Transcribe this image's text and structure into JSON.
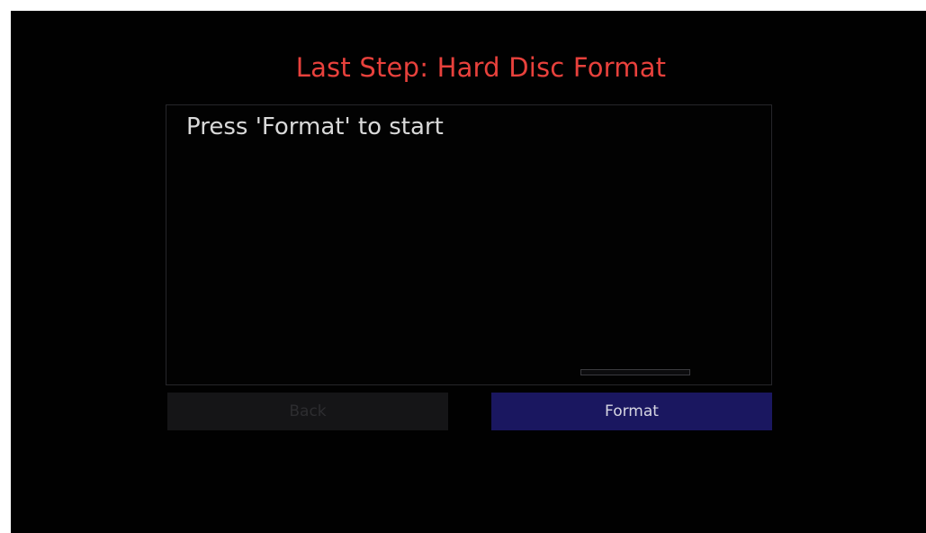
{
  "dialog": {
    "title": "Last Step: Hard Disc Format",
    "message": "Press 'Format' to start",
    "progress_fraction": 0
  },
  "buttons": {
    "back_label": "Back",
    "format_label": "Format"
  },
  "colors": {
    "background": "#010101",
    "title": "#e8413c",
    "message_text": "#d9d9d9",
    "back_button_bg": "#151517",
    "format_button_bg": "#1a1760"
  }
}
